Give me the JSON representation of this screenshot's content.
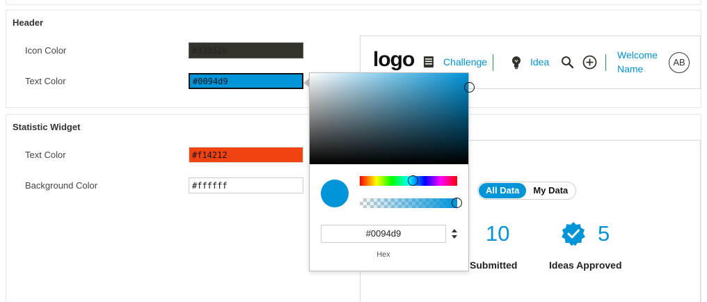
{
  "header_section": {
    "title": "Header",
    "icon_color": {
      "label": "Icon Color",
      "value": "#33332b"
    },
    "text_color": {
      "label": "Text Color",
      "value": "#0094d9"
    }
  },
  "statistic_section": {
    "title": "Statistic Widget",
    "text_color": {
      "label": "Text Color",
      "value": "#f14212"
    },
    "background_color": {
      "label": "Background Color",
      "value": "#ffffff"
    }
  },
  "header_preview": {
    "logo": "logo",
    "challenge_label": "Challenge",
    "idea_label": "Idea",
    "welcome_line1": "Welcome",
    "welcome_line2": "Name",
    "avatar_initials": "AB",
    "icons": [
      "challenge-icon",
      "lightbulb-icon",
      "search-icon",
      "add-circle-icon"
    ]
  },
  "stat_preview": {
    "toggle": {
      "all": "All Data",
      "mine": "My Data",
      "selected": "All Data"
    },
    "stat1": {
      "value": "10",
      "label": "Submitted"
    },
    "stat2": {
      "value": "5",
      "label": "Ideas Approved"
    }
  },
  "color_picker": {
    "hex_value": "#0094d9",
    "hex_label": "Hex",
    "current_color": "#0094d9",
    "alpha": 1.0
  },
  "colors": {
    "accent": "#0094d9",
    "icon": "#33332b",
    "stat_text": "#f14212",
    "separator": "#1c9a3c"
  }
}
